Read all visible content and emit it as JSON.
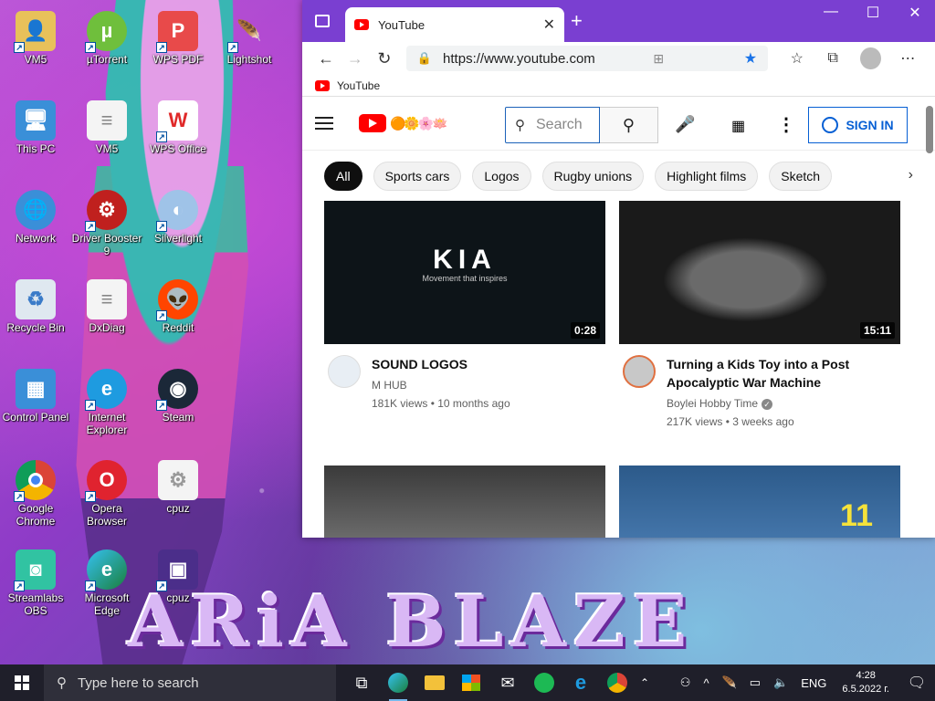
{
  "desktop": {
    "wallpaper_text": "ARiA BLAZE",
    "icons": [
      {
        "label": "VM5"
      },
      {
        "label": "µTorrent"
      },
      {
        "label": "WPS PDF"
      },
      {
        "label": "Lightshot"
      },
      {
        "label": "This PC"
      },
      {
        "label": "VM5"
      },
      {
        "label": "WPS Office"
      },
      {
        "label": "Network"
      },
      {
        "label": "Driver Booster 9"
      },
      {
        "label": "Silverlight"
      },
      {
        "label": "Recycle Bin"
      },
      {
        "label": "DxDiag"
      },
      {
        "label": "Reddit"
      },
      {
        "label": "Control Panel"
      },
      {
        "label": "Internet Explorer"
      },
      {
        "label": "Steam"
      },
      {
        "label": "Google Chrome"
      },
      {
        "label": "Opera Browser"
      },
      {
        "label": "cpuz"
      },
      {
        "label": "Streamlabs OBS"
      },
      {
        "label": "Microsoft Edge"
      },
      {
        "label": "cpuz"
      }
    ]
  },
  "browser": {
    "tab_title": "YouTube",
    "new_tab_symbol": "+",
    "url": "https://www.youtube.com",
    "favorites_bar": {
      "item": "YouTube"
    },
    "accent_color": "#7a3fd1"
  },
  "youtube": {
    "search_placeholder": "Search",
    "sign_in_label": "SIGN IN",
    "chips": [
      "All",
      "Sports cars",
      "Logos",
      "Rugby unions",
      "Highlight films",
      "Sketch"
    ],
    "videos": [
      {
        "title": "SOUND LOGOS",
        "channel": "M HUB",
        "stats": "181K views • 10 months ago",
        "duration": "0:28",
        "thumb_text": "KIA",
        "thumb_subtext": "Movement that inspires"
      },
      {
        "title": "Turning a Kids Toy into a Post Apocalyptic War Machine",
        "channel": "Boylei Hobby Time",
        "stats": "217K views • 3 weeks ago",
        "duration": "15:11",
        "verified": true
      }
    ],
    "third_thumb_text": "11"
  },
  "taskbar": {
    "search_placeholder": "Type here to search",
    "language": "ENG",
    "time": "4:28",
    "date": "6.5.2022 г."
  }
}
